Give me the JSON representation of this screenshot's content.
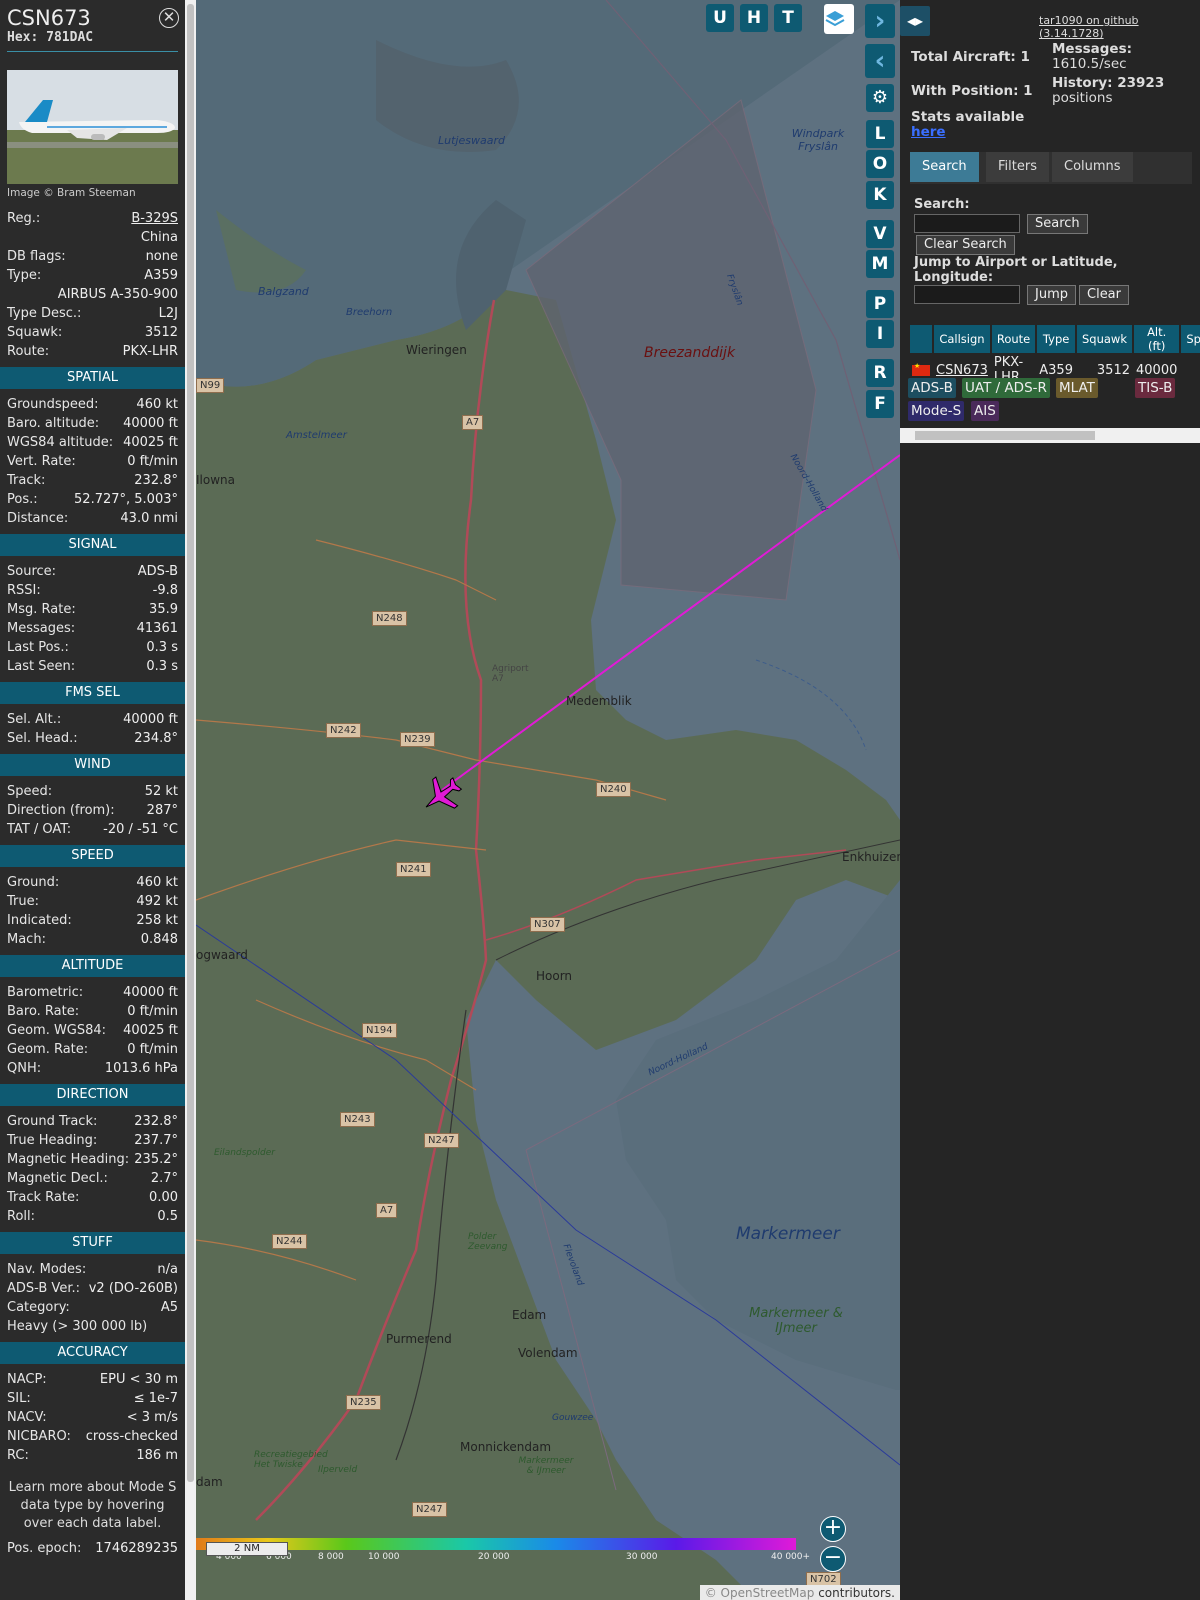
{
  "aircraft": {
    "callsign": "CSN673",
    "hex_label": "Hex: 781DAC",
    "image_credit": "Image © Bram Steeman",
    "basics": [
      {
        "k": "Reg.:",
        "v": "B-329S",
        "link": true
      },
      {
        "k": "",
        "v": "China"
      },
      {
        "k": "DB flags:",
        "v": "none"
      },
      {
        "k": "Type:",
        "v": "A359"
      },
      {
        "k": "",
        "v": "AIRBUS A-350-900"
      },
      {
        "k": "Type Desc.:",
        "v": "L2J"
      },
      {
        "k": "Squawk:",
        "v": "3512"
      },
      {
        "k": "Route:",
        "v": "PKX-LHR"
      }
    ]
  },
  "sections": [
    {
      "title": "SPATIAL",
      "rows": [
        {
          "k": "Groundspeed:",
          "v": "460 kt"
        },
        {
          "k": "Baro. altitude:",
          "v": "40000 ft"
        },
        {
          "k": "WGS84 altitude:",
          "v": "40025 ft"
        },
        {
          "k": "Vert. Rate:",
          "v": "0 ft/min"
        },
        {
          "k": "Track:",
          "v": "232.8°"
        },
        {
          "k": "Pos.:",
          "v": "52.727°, 5.003°"
        },
        {
          "k": "Distance:",
          "v": "43.0 nmi"
        }
      ]
    },
    {
      "title": "SIGNAL",
      "rows": [
        {
          "k": "Source:",
          "v": "ADS-B"
        },
        {
          "k": "RSSI:",
          "v": "-9.8"
        },
        {
          "k": "Msg. Rate:",
          "v": "35.9"
        },
        {
          "k": "Messages:",
          "v": "41361"
        },
        {
          "k": "Last Pos.:",
          "v": "0.3 s"
        },
        {
          "k": "Last Seen:",
          "v": "0.3 s"
        }
      ]
    },
    {
      "title": "FMS SEL",
      "rows": [
        {
          "k": "Sel. Alt.:",
          "v": "40000 ft"
        },
        {
          "k": "Sel. Head.:",
          "v": "234.8°"
        }
      ]
    },
    {
      "title": "WIND",
      "rows": [
        {
          "k": "Speed:",
          "v": "52 kt"
        },
        {
          "k": "Direction (from):",
          "v": "287°"
        },
        {
          "k": "TAT / OAT:",
          "v": "-20 / -51 °C"
        }
      ]
    },
    {
      "title": "SPEED",
      "rows": [
        {
          "k": "Ground:",
          "v": "460 kt"
        },
        {
          "k": "True:",
          "v": "492 kt"
        },
        {
          "k": "Indicated:",
          "v": "258 kt"
        },
        {
          "k": "Mach:",
          "v": "0.848"
        }
      ]
    },
    {
      "title": "ALTITUDE",
      "rows": [
        {
          "k": "Barometric:",
          "v": "40000 ft"
        },
        {
          "k": "Baro. Rate:",
          "v": "0 ft/min"
        },
        {
          "k": "Geom. WGS84:",
          "v": "40025 ft"
        },
        {
          "k": "Geom. Rate:",
          "v": "0 ft/min"
        },
        {
          "k": "QNH:",
          "v": "1013.6 hPa"
        }
      ]
    },
    {
      "title": "DIRECTION",
      "rows": [
        {
          "k": "Ground Track:",
          "v": "232.8°"
        },
        {
          "k": "True Heading:",
          "v": "237.7°"
        },
        {
          "k": "Magnetic Heading:",
          "v": "235.2°"
        },
        {
          "k": "Magnetic Decl.:",
          "v": "2.7°"
        },
        {
          "k": "Track Rate:",
          "v": "0.00"
        },
        {
          "k": "Roll:",
          "v": "0.5"
        }
      ]
    },
    {
      "title": "STUFF",
      "rows": [
        {
          "k": "Nav. Modes:",
          "v": "n/a"
        },
        {
          "k": "ADS-B Ver.:",
          "v": "v2 (DO-260B)"
        },
        {
          "k": "Category:",
          "v": "A5"
        },
        {
          "k": "Heavy (> 300 000 lb)",
          "v": ""
        }
      ]
    },
    {
      "title": "ACCURACY",
      "rows": [
        {
          "k": "NACP:",
          "v": "EPU < 30 m"
        },
        {
          "k": "SIL:",
          "v": "≤ 1e-7"
        },
        {
          "k": "NACV:",
          "v": "< 3 m/s"
        },
        {
          "k": "NICBARO:",
          "v": "cross-checked"
        },
        {
          "k": "RC:",
          "v": "186 m"
        }
      ]
    }
  ],
  "learn_more": "Learn more about Mode S data type by hovering over each data label.",
  "pos_epoch": {
    "k": "Pos. epoch:",
    "v": "1746289235"
  },
  "map": {
    "buttons_top": [
      "U",
      "H",
      "T"
    ],
    "side_buttons": [
      "L",
      "O",
      "K",
      "V",
      "M",
      "P",
      "I",
      "R",
      "F"
    ],
    "places": [
      "Lutjeswaard",
      "Windpark Fryslân",
      "Balgzand",
      "Breehorn",
      "Wieringen",
      "Breezanddijk",
      "Amstelmeer",
      "Medemblik",
      "Agriport A7",
      "Enkhuizen",
      "Hoorn",
      "Eilandspolder",
      "Polder Zeevang",
      "Markermeer",
      "Markermeer & IJmeer",
      "Edam",
      "Volendam",
      "Purmerend",
      "Monnickendam",
      "Recreatiegebied Het Twiske",
      "Ilperveld",
      "Gouwzee",
      "Markermeer & IJmeer",
      "Noord-Holland",
      "Noord-Holland",
      "Fryslân",
      "Flevoland",
      "Ilowna",
      "ogwaard",
      "dam"
    ],
    "roads": [
      "A7",
      "N99",
      "N248",
      "N242",
      "N239",
      "N240",
      "N241",
      "N307",
      "N194",
      "N243",
      "N247",
      "A7",
      "N244",
      "N235",
      "N247",
      "N702"
    ],
    "color_scale_labels": [
      "4 000",
      "6 000",
      "8 000",
      "10 000",
      "20 000",
      "30 000",
      "40 000+"
    ],
    "scale_label": "2 NM",
    "attribution_symbol": "©",
    "attribution_link": "OpenStreetMap",
    "attribution_text": " contributors."
  },
  "right": {
    "github": "tar1090 on github (3.14.1728)",
    "total_aircraft": "Total Aircraft: 1",
    "with_position": "With Position: 1",
    "messages_label": "Messages:",
    "messages_value": "1610.5/sec",
    "history_label": "History: 23923",
    "history_value": "positions",
    "stats_label": "Stats available",
    "stats_link": "here",
    "tabs": [
      "Search",
      "Filters",
      "Columns"
    ],
    "search_label": "Search:",
    "search_btn": "Search",
    "clear_search_btn": "Clear Search",
    "jump_label": "Jump to Airport or Latitude, Longitude:",
    "jump_btn": "Jump",
    "clear_btn": "Clear",
    "table_headers": [
      "",
      "Callsign",
      "Route",
      "Type",
      "Squawk",
      "Alt. (ft)",
      "Sp"
    ],
    "table_row": {
      "callsign": "CSN673",
      "route": "PKX-LHR",
      "type": "A359",
      "squawk": "3512",
      "alt": "40000"
    },
    "source_chips": [
      {
        "label": "ADS-B",
        "color": "#1d4e60"
      },
      {
        "label": "UAT / ADS-R",
        "color": "#2f6a3a"
      },
      {
        "label": "MLAT",
        "color": "#6a5a2c"
      },
      {
        "label": "TIS-B",
        "color": "#6a2a3e"
      },
      {
        "label": "Mode-S",
        "color": "#2f2a6a"
      },
      {
        "label": "AIS",
        "color": "#4a2a5a"
      }
    ]
  }
}
